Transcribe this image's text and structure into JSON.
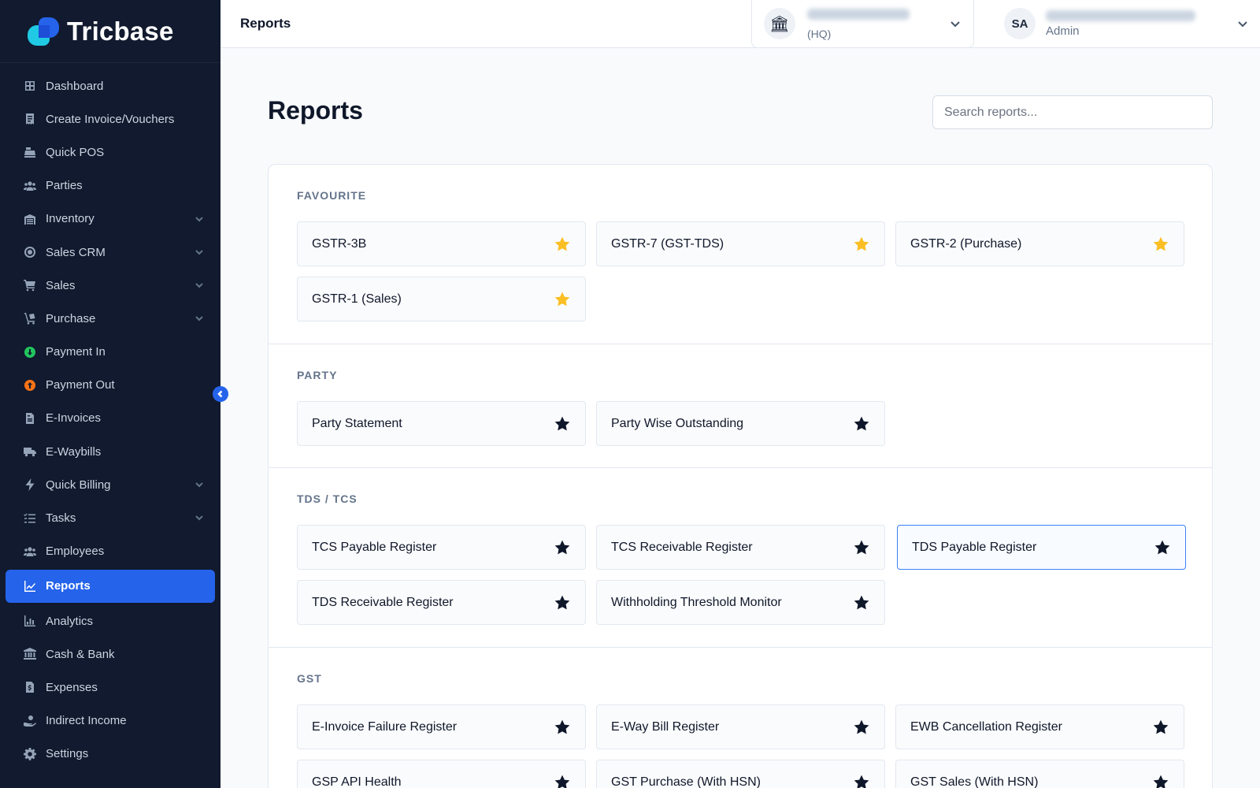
{
  "brand": {
    "name": "Tricbase"
  },
  "sidebar": {
    "items": [
      {
        "label": "Dashboard",
        "icon": "grid-icon",
        "expandable": false
      },
      {
        "label": "Create Invoice/Vouchers",
        "icon": "receipt-icon",
        "expandable": false
      },
      {
        "label": "Quick POS",
        "icon": "cash-register-icon",
        "expandable": false
      },
      {
        "label": "Parties",
        "icon": "users-icon",
        "expandable": false
      },
      {
        "label": "Inventory",
        "icon": "warehouse-icon",
        "expandable": true
      },
      {
        "label": "Sales CRM",
        "icon": "target-icon",
        "expandable": true
      },
      {
        "label": "Sales",
        "icon": "cart-icon",
        "expandable": true
      },
      {
        "label": "Purchase",
        "icon": "trolley-icon",
        "expandable": true
      },
      {
        "label": "Payment In",
        "icon": "arrow-down-circle-icon",
        "expandable": false
      },
      {
        "label": "Payment Out",
        "icon": "arrow-up-circle-icon",
        "expandable": false
      },
      {
        "label": "E-Invoices",
        "icon": "file-invoice-icon",
        "expandable": false
      },
      {
        "label": "E-Waybills",
        "icon": "truck-icon",
        "expandable": false
      },
      {
        "label": "Quick Billing",
        "icon": "bolt-icon",
        "expandable": true
      },
      {
        "label": "Tasks",
        "icon": "list-check-icon",
        "expandable": true
      },
      {
        "label": "Employees",
        "icon": "users-icon",
        "expandable": false
      },
      {
        "label": "Reports",
        "icon": "chart-line-icon",
        "expandable": false,
        "active": true
      },
      {
        "label": "Analytics",
        "icon": "chart-bar-icon",
        "expandable": false
      },
      {
        "label": "Cash & Bank",
        "icon": "bank-icon",
        "expandable": false
      },
      {
        "label": "Expenses",
        "icon": "file-dollar-icon",
        "expandable": false
      },
      {
        "label": "Indirect Income",
        "icon": "hand-coin-icon",
        "expandable": false
      },
      {
        "label": "Settings",
        "icon": "gear-icon",
        "expandable": false
      }
    ]
  },
  "topbar": {
    "title": "Reports",
    "org": {
      "sub": "(HQ)",
      "icon": "bank-building-icon"
    },
    "user": {
      "initials": "SA",
      "role": "Admin"
    }
  },
  "main": {
    "title": "Reports",
    "search_placeholder": "Search reports...",
    "sections": [
      {
        "title": "FAVOURITE",
        "reports": [
          {
            "label": "GSTR-3B",
            "favourite": true
          },
          {
            "label": "GSTR-7 (GST-TDS)",
            "favourite": true
          },
          {
            "label": "GSTR-2 (Purchase)",
            "favourite": true
          },
          {
            "label": "GSTR-1 (Sales)",
            "favourite": true
          }
        ]
      },
      {
        "title": "PARTY",
        "reports": [
          {
            "label": "Party Statement",
            "favourite": false
          },
          {
            "label": "Party Wise Outstanding",
            "favourite": false
          }
        ]
      },
      {
        "title": "TDS / TCS",
        "reports": [
          {
            "label": "TCS Payable Register",
            "favourite": false
          },
          {
            "label": "TCS Receivable Register",
            "favourite": false
          },
          {
            "label": "TDS Payable Register",
            "favourite": false,
            "selected": true
          },
          {
            "label": "TDS Receivable Register",
            "favourite": false
          },
          {
            "label": "Withholding Threshold Monitor",
            "favourite": false
          }
        ]
      },
      {
        "title": "GST",
        "reports": [
          {
            "label": "E-Invoice Failure Register",
            "favourite": false
          },
          {
            "label": "E-Way Bill Register",
            "favourite": false
          },
          {
            "label": "EWB Cancellation Register",
            "favourite": false
          },
          {
            "label": "GSP API Health",
            "favourite": false
          },
          {
            "label": "GST Purchase (With HSN)",
            "favourite": false
          },
          {
            "label": "GST Sales (With HSN)",
            "favourite": false
          }
        ]
      }
    ]
  },
  "colors": {
    "sidebar_bg": "#111a2e",
    "accent": "#2563eb",
    "favourite_star": "#fbbf24",
    "payment_in": "#22c55e",
    "payment_out": "#f97316"
  }
}
